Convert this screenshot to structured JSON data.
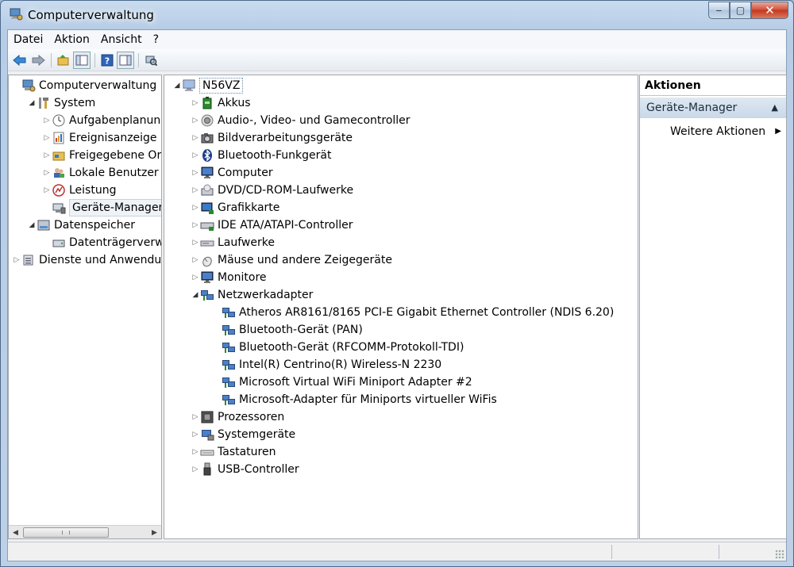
{
  "window": {
    "title": "Computerverwaltung",
    "buttons": {
      "minimize": "‒",
      "maximize": "▢",
      "close": "✕"
    }
  },
  "menubar": [
    "Datei",
    "Aktion",
    "Ansicht",
    "?"
  ],
  "toolbar": {
    "buttons": [
      "back-icon",
      "forward-icon",
      "up-icon",
      "show-hide-console-tree-icon",
      "help-icon",
      "properties-icon",
      "scan-hardware-icon"
    ]
  },
  "left_tree": [
    {
      "label": "Computerverwaltung (Lo",
      "icon": "computer-management-icon",
      "expander": ""
    },
    {
      "label": "System",
      "icon": "tools-icon",
      "expander": "expanded"
    },
    {
      "label": "Aufgabenplanung",
      "icon": "clock-icon",
      "expander": "collapsed"
    },
    {
      "label": "Ereignisanzeige",
      "icon": "event-viewer-icon",
      "expander": "collapsed"
    },
    {
      "label": "Freigegebene Ordn",
      "icon": "shared-folder-icon",
      "expander": "collapsed"
    },
    {
      "label": "Lokale Benutzer un",
      "icon": "users-icon",
      "expander": "collapsed"
    },
    {
      "label": "Leistung",
      "icon": "performance-icon",
      "expander": "collapsed"
    },
    {
      "label": "Geräte-Manager",
      "icon": "device-manager-icon",
      "expander": "",
      "selected": true
    },
    {
      "label": "Datenspeicher",
      "icon": "storage-icon",
      "expander": "expanded"
    },
    {
      "label": "Datenträgerverwalt",
      "icon": "disk-management-icon",
      "expander": ""
    },
    {
      "label": "Dienste und Anwendu",
      "icon": "services-icon",
      "expander": "collapsed"
    }
  ],
  "device_tree": {
    "root": "N56VZ",
    "categories": [
      {
        "label": "Akkus",
        "icon": "battery-icon",
        "expanded": false
      },
      {
        "label": "Audio-, Video- und Gamecontroller",
        "icon": "speaker-icon",
        "expanded": false
      },
      {
        "label": "Bildverarbeitungsgeräte",
        "icon": "camera-icon",
        "expanded": false
      },
      {
        "label": "Bluetooth-Funkgerät",
        "icon": "bluetooth-icon",
        "expanded": false
      },
      {
        "label": "Computer",
        "icon": "monitor-icon",
        "expanded": false
      },
      {
        "label": "DVD/CD-ROM-Laufwerke",
        "icon": "dvd-drive-icon",
        "expanded": false
      },
      {
        "label": "Grafikkarte",
        "icon": "display-adapter-icon",
        "expanded": false
      },
      {
        "label": "IDE ATA/ATAPI-Controller",
        "icon": "ide-controller-icon",
        "expanded": false
      },
      {
        "label": "Laufwerke",
        "icon": "disk-drive-icon",
        "expanded": false
      },
      {
        "label": "Mäuse und andere Zeigegeräte",
        "icon": "mouse-icon",
        "expanded": false
      },
      {
        "label": "Monitore",
        "icon": "monitor-icon",
        "expanded": false
      },
      {
        "label": "Netzwerkadapter",
        "icon": "network-adapter-icon",
        "expanded": true,
        "children": [
          "Atheros AR8161/8165 PCI-E Gigabit Ethernet Controller (NDIS 6.20)",
          "Bluetooth-Gerät (PAN)",
          "Bluetooth-Gerät (RFCOMM-Protokoll-TDI)",
          "Intel(R) Centrino(R) Wireless-N 2230",
          "Microsoft Virtual WiFi Miniport Adapter #2",
          "Microsoft-Adapter für Miniports virtueller WiFis"
        ]
      },
      {
        "label": "Prozessoren",
        "icon": "processor-icon",
        "expanded": false
      },
      {
        "label": "Systemgeräte",
        "icon": "system-devices-icon",
        "expanded": false
      },
      {
        "label": "Tastaturen",
        "icon": "keyboard-icon",
        "expanded": false
      },
      {
        "label": "USB-Controller",
        "icon": "usb-icon",
        "expanded": false
      }
    ]
  },
  "actions": {
    "header": "Aktionen",
    "group": "Geräte-Manager",
    "items": [
      "Weitere Aktionen"
    ]
  }
}
